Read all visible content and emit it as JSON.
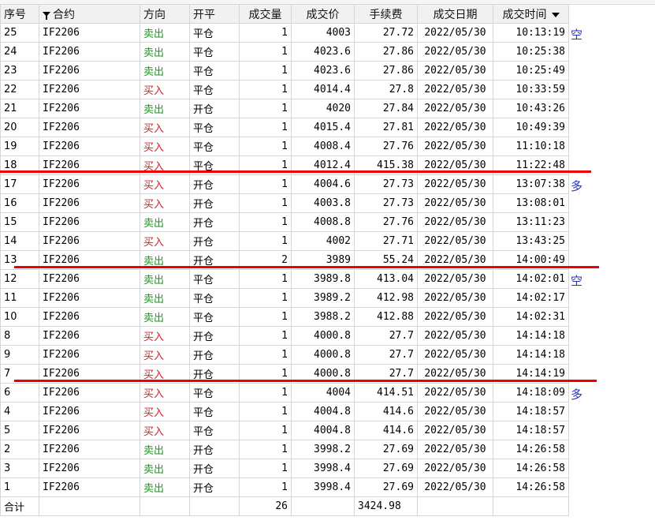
{
  "columns": {
    "seq": "序号",
    "contract": "合约",
    "direction": "方向",
    "openclose": "开平",
    "volume": "成交量",
    "price": "成交价",
    "fee": "手续费",
    "date": "成交日期",
    "time": "成交时间"
  },
  "colors": {
    "sell": "#1a9a1a",
    "buy": "#d62020",
    "note": "#2030c0",
    "marker": "#ee0000"
  },
  "rows": [
    {
      "seq": "25",
      "contract": "IF2206",
      "dir": "卖出",
      "oc": "平仓",
      "vol": "1",
      "price": "4003",
      "fee": "27.72",
      "date": "2022/05/30",
      "time": "10:13:19",
      "note": "空"
    },
    {
      "seq": "24",
      "contract": "IF2206",
      "dir": "卖出",
      "oc": "平仓",
      "vol": "1",
      "price": "4023.6",
      "fee": "27.86",
      "date": "2022/05/30",
      "time": "10:25:38",
      "note": ""
    },
    {
      "seq": "23",
      "contract": "IF2206",
      "dir": "卖出",
      "oc": "平仓",
      "vol": "1",
      "price": "4023.6",
      "fee": "27.86",
      "date": "2022/05/30",
      "time": "10:25:49",
      "note": ""
    },
    {
      "seq": "22",
      "contract": "IF2206",
      "dir": "买入",
      "oc": "平仓",
      "vol": "1",
      "price": "4014.4",
      "fee": "27.8",
      "date": "2022/05/30",
      "time": "10:33:59",
      "note": ""
    },
    {
      "seq": "21",
      "contract": "IF2206",
      "dir": "卖出",
      "oc": "开仓",
      "vol": "1",
      "price": "4020",
      "fee": "27.84",
      "date": "2022/05/30",
      "time": "10:43:26",
      "note": ""
    },
    {
      "seq": "20",
      "contract": "IF2206",
      "dir": "买入",
      "oc": "平仓",
      "vol": "1",
      "price": "4015.4",
      "fee": "27.81",
      "date": "2022/05/30",
      "time": "10:49:39",
      "note": ""
    },
    {
      "seq": "19",
      "contract": "IF2206",
      "dir": "买入",
      "oc": "平仓",
      "vol": "1",
      "price": "4008.4",
      "fee": "27.76",
      "date": "2022/05/30",
      "time": "11:10:18",
      "note": ""
    },
    {
      "seq": "18",
      "contract": "IF2206",
      "dir": "买入",
      "oc": "平仓",
      "vol": "1",
      "price": "4012.4",
      "fee": "415.38",
      "date": "2022/05/30",
      "time": "11:22:48",
      "note": ""
    },
    {
      "seq": "17",
      "contract": "IF2206",
      "dir": "买入",
      "oc": "开仓",
      "vol": "1",
      "price": "4004.6",
      "fee": "27.73",
      "date": "2022/05/30",
      "time": "13:07:38",
      "note": "多"
    },
    {
      "seq": "16",
      "contract": "IF2206",
      "dir": "买入",
      "oc": "开仓",
      "vol": "1",
      "price": "4003.8",
      "fee": "27.73",
      "date": "2022/05/30",
      "time": "13:08:01",
      "note": ""
    },
    {
      "seq": "15",
      "contract": "IF2206",
      "dir": "卖出",
      "oc": "开仓",
      "vol": "1",
      "price": "4008.8",
      "fee": "27.76",
      "date": "2022/05/30",
      "time": "13:11:23",
      "note": ""
    },
    {
      "seq": "14",
      "contract": "IF2206",
      "dir": "买入",
      "oc": "开仓",
      "vol": "1",
      "price": "4002",
      "fee": "27.71",
      "date": "2022/05/30",
      "time": "13:43:25",
      "note": ""
    },
    {
      "seq": "13",
      "contract": "IF2206",
      "dir": "卖出",
      "oc": "开仓",
      "vol": "2",
      "price": "3989",
      "fee": "55.24",
      "date": "2022/05/30",
      "time": "14:00:49",
      "note": ""
    },
    {
      "seq": "12",
      "contract": "IF2206",
      "dir": "卖出",
      "oc": "平仓",
      "vol": "1",
      "price": "3989.8",
      "fee": "413.04",
      "date": "2022/05/30",
      "time": "14:02:01",
      "note": "空"
    },
    {
      "seq": "11",
      "contract": "IF2206",
      "dir": "卖出",
      "oc": "平仓",
      "vol": "1",
      "price": "3989.2",
      "fee": "412.98",
      "date": "2022/05/30",
      "time": "14:02:17",
      "note": ""
    },
    {
      "seq": "10",
      "contract": "IF2206",
      "dir": "卖出",
      "oc": "平仓",
      "vol": "1",
      "price": "3988.2",
      "fee": "412.88",
      "date": "2022/05/30",
      "time": "14:02:31",
      "note": ""
    },
    {
      "seq": "8",
      "contract": "IF2206",
      "dir": "买入",
      "oc": "开仓",
      "vol": "1",
      "price": "4000.8",
      "fee": "27.7",
      "date": "2022/05/30",
      "time": "14:14:18",
      "note": ""
    },
    {
      "seq": "9",
      "contract": "IF2206",
      "dir": "买入",
      "oc": "开仓",
      "vol": "1",
      "price": "4000.8",
      "fee": "27.7",
      "date": "2022/05/30",
      "time": "14:14:18",
      "note": ""
    },
    {
      "seq": "7",
      "contract": "IF2206",
      "dir": "买入",
      "oc": "开仓",
      "vol": "1",
      "price": "4000.8",
      "fee": "27.7",
      "date": "2022/05/30",
      "time": "14:14:19",
      "note": ""
    },
    {
      "seq": "6",
      "contract": "IF2206",
      "dir": "买入",
      "oc": "平仓",
      "vol": "1",
      "price": "4004",
      "fee": "414.51",
      "date": "2022/05/30",
      "time": "14:18:09",
      "note": "多"
    },
    {
      "seq": "4",
      "contract": "IF2206",
      "dir": "买入",
      "oc": "平仓",
      "vol": "1",
      "price": "4004.8",
      "fee": "414.6",
      "date": "2022/05/30",
      "time": "14:18:57",
      "note": ""
    },
    {
      "seq": "5",
      "contract": "IF2206",
      "dir": "买入",
      "oc": "平仓",
      "vol": "1",
      "price": "4004.8",
      "fee": "414.6",
      "date": "2022/05/30",
      "time": "14:18:57",
      "note": ""
    },
    {
      "seq": "2",
      "contract": "IF2206",
      "dir": "卖出",
      "oc": "开仓",
      "vol": "1",
      "price": "3998.2",
      "fee": "27.69",
      "date": "2022/05/30",
      "time": "14:26:58",
      "note": ""
    },
    {
      "seq": "3",
      "contract": "IF2206",
      "dir": "卖出",
      "oc": "开仓",
      "vol": "1",
      "price": "3998.4",
      "fee": "27.69",
      "date": "2022/05/30",
      "time": "14:26:58",
      "note": ""
    },
    {
      "seq": "1",
      "contract": "IF2206",
      "dir": "卖出",
      "oc": "开仓",
      "vol": "1",
      "price": "3998.4",
      "fee": "27.69",
      "date": "2022/05/30",
      "time": "14:26:58",
      "note": ""
    }
  ],
  "total": {
    "label": "合计",
    "volume": "26",
    "fee": "3424.98"
  }
}
